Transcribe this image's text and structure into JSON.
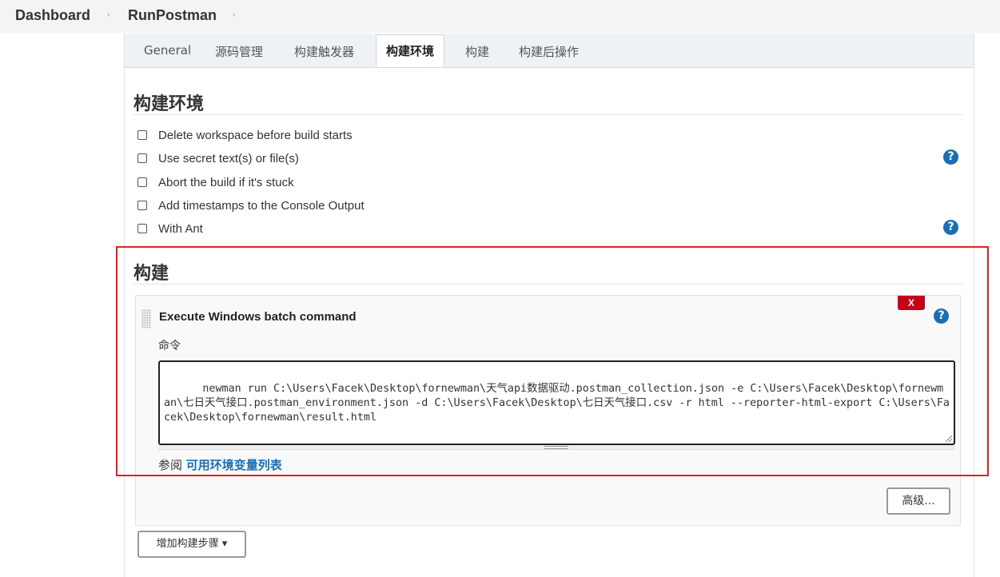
{
  "breadcrumb": {
    "items": [
      "Dashboard",
      "RunPostman"
    ],
    "separator": "›"
  },
  "tabs": [
    "General",
    "源码管理",
    "构建触发器",
    "构建环境",
    "构建",
    "构建后操作"
  ],
  "active_tab": "构建环境",
  "build_env": {
    "title": "构建环境",
    "options": [
      {
        "label": "Delete workspace before build starts",
        "checked": false
      },
      {
        "label": "Use secret text(s) or file(s)",
        "checked": false,
        "help": true
      },
      {
        "label": "Abort the build if it's stuck",
        "checked": false
      },
      {
        "label": "Add timestamps to the Console Output",
        "checked": false
      },
      {
        "label": "With Ant",
        "checked": false,
        "help": true
      }
    ]
  },
  "build": {
    "title": "构建",
    "step": {
      "title": "Execute Windows batch command",
      "delete_label": "X",
      "command_label": "命令",
      "command": "newman run C:\\Users\\Facek\\Desktop\\fornewman\\天气api数据驱动.postman_collection.json -e C:\\Users\\Facek\\Desktop\\fornewman\\七日天气接口.postman_environment.json -d C:\\Users\\Facek\\Desktop\\七日天气接口.csv -r html --reporter-html-export C:\\Users\\Facek\\Desktop\\fornewman\\result.html",
      "see_also_prefix": "参阅",
      "see_also_link": "可用环境变量列表",
      "advanced_label": "高级..."
    },
    "add_step_label": "增加构建步骤 ▾"
  },
  "help_glyph": "?",
  "colors": {
    "accent": "#1c6eb4",
    "delete": "#c4001a",
    "highlight": "#e02020"
  }
}
